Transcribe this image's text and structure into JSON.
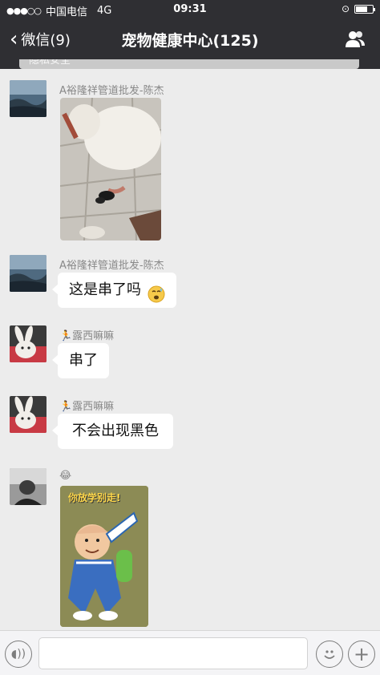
{
  "status": {
    "carrier": "中国电信",
    "network": "4G",
    "time": "09:31"
  },
  "nav": {
    "back_label": "微信(9)",
    "title": "宠物健康中心(125)"
  },
  "banner": {
    "text": "隐私安全"
  },
  "messages": [
    {
      "sender": "A裕隆祥管道批发-陈杰",
      "type": "image"
    },
    {
      "sender": "A裕隆祥管道批发-陈杰",
      "type": "text",
      "text": "这是串了吗",
      "emoji": "sweat-smile-emoji"
    },
    {
      "sender": "🏃露西嘛嘛",
      "type": "text",
      "text": "串了"
    },
    {
      "sender": "🏃露西嘛嘛",
      "type": "text",
      "text": "不会出现黑色"
    },
    {
      "sender": "😂",
      "type": "sticker",
      "sticker_caption": "你放学别走!"
    }
  ],
  "input": {
    "placeholder": ""
  },
  "colors": {
    "nav_bg": "#2f2f33",
    "chat_bg": "#ececec",
    "bubble_bg": "#ffffff"
  }
}
